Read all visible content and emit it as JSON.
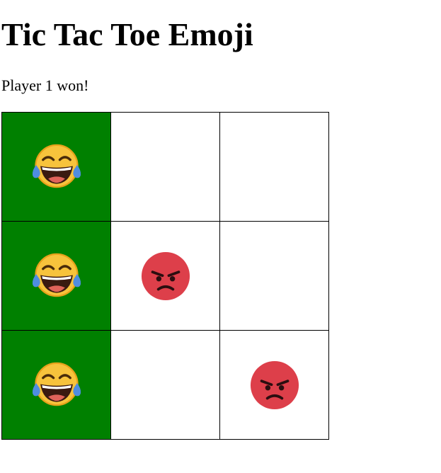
{
  "title": "Tic Tac Toe Emoji",
  "status": "Player 1 won!",
  "colors": {
    "win_highlight": "#008000",
    "grid_line": "#000000",
    "laugh_face": "#F7C33C",
    "angry_face": "#DD3F4A"
  },
  "board": {
    "cells": [
      {
        "mark": "tears-of-joy-emoji",
        "player": 1,
        "winning": true
      },
      {
        "mark": "",
        "player": 0,
        "winning": false
      },
      {
        "mark": "",
        "player": 0,
        "winning": false
      },
      {
        "mark": "tears-of-joy-emoji",
        "player": 1,
        "winning": true
      },
      {
        "mark": "angry-face-emoji",
        "player": 2,
        "winning": false
      },
      {
        "mark": "",
        "player": 0,
        "winning": false
      },
      {
        "mark": "tears-of-joy-emoji",
        "player": 1,
        "winning": true
      },
      {
        "mark": "",
        "player": 0,
        "winning": false
      },
      {
        "mark": "angry-face-emoji",
        "player": 2,
        "winning": false
      }
    ]
  }
}
